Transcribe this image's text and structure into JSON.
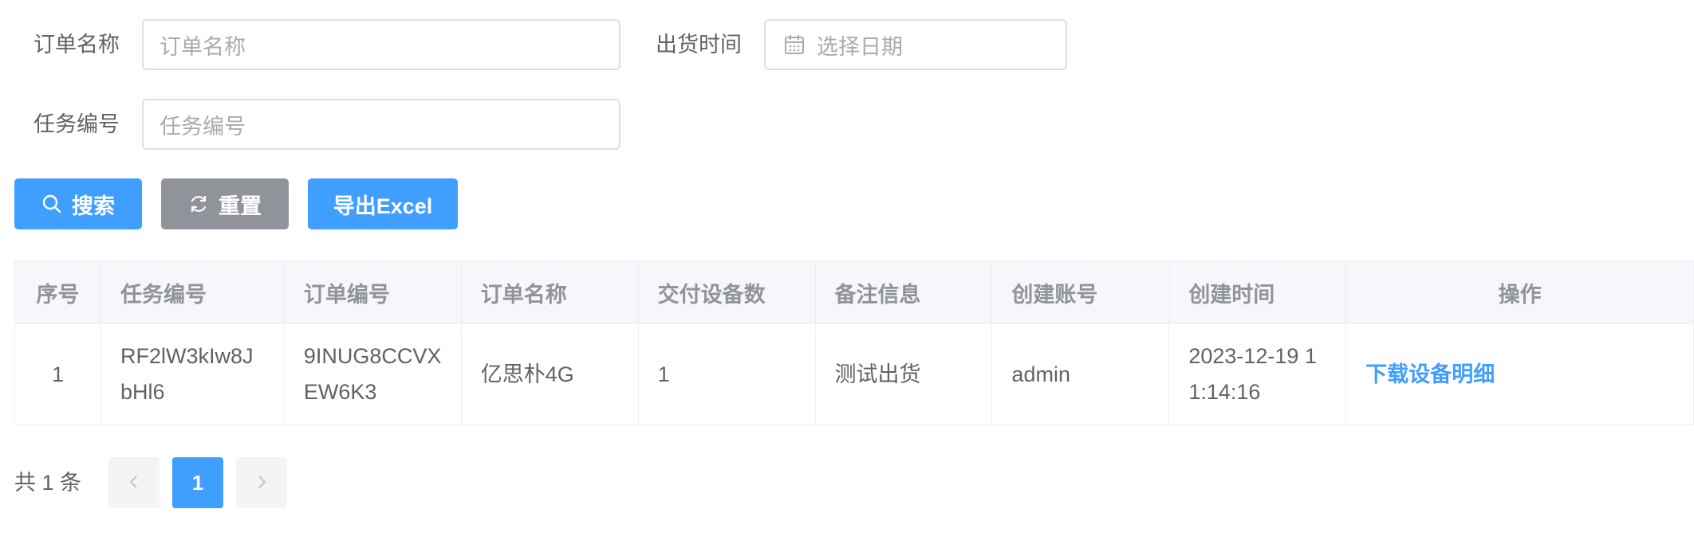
{
  "form": {
    "order_name_label": "订单名称",
    "order_name_placeholder": "订单名称",
    "ship_time_label": "出货时间",
    "ship_time_placeholder": "选择日期",
    "task_no_label": "任务编号",
    "task_no_placeholder": "任务编号"
  },
  "toolbar": {
    "search_label": "搜索",
    "reset_label": "重置",
    "export_label": "导出Excel"
  },
  "table": {
    "headers": [
      "序号",
      "任务编号",
      "订单编号",
      "订单名称",
      "交付设备数",
      "备注信息",
      "创建账号",
      "创建时间",
      "操作"
    ],
    "rows": [
      {
        "index": "1",
        "task_no": "RF2lW3kIw8JbHl6",
        "order_no": "9INUG8CCVXEW6K3",
        "order_name": "亿思朴4G",
        "device_count": "1",
        "remark": "测试出货",
        "account": "admin",
        "created_at": "2023-12-19 11:14:16",
        "action": "下载设备明细"
      }
    ]
  },
  "pagination": {
    "total_text": "共 1 条",
    "current_page": "1"
  },
  "colors": {
    "primary": "#409eff",
    "gray_button": "#909399",
    "header_bg": "#f5f7fa",
    "border": "#ebeef5"
  }
}
